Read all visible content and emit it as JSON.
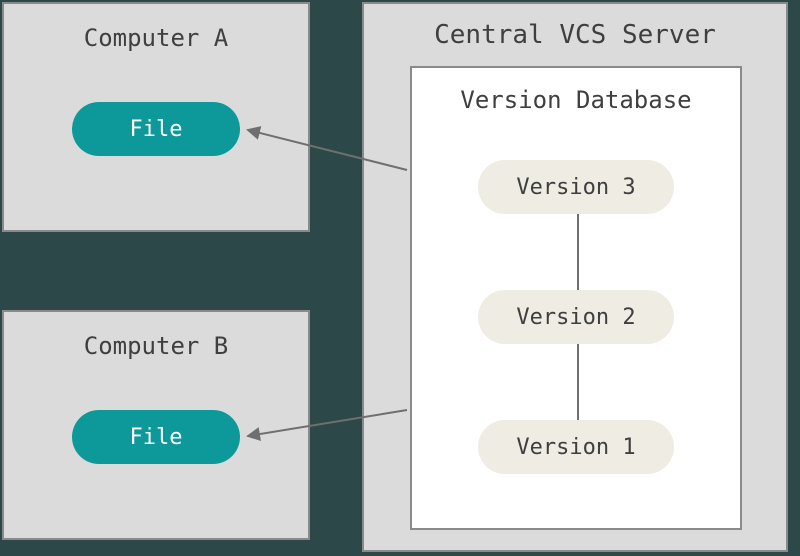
{
  "computerA": {
    "title": "Computer A",
    "file_label": "File"
  },
  "computerB": {
    "title": "Computer B",
    "file_label": "File"
  },
  "server": {
    "title": "Central VCS Server",
    "database": {
      "title": "Version Database",
      "versions": [
        "Version 3",
        "Version 2",
        "Version 1"
      ]
    }
  },
  "colors": {
    "accent": "#0d9999",
    "box_bg": "#dbdbdb",
    "canvas_bg": "#2d4848"
  }
}
